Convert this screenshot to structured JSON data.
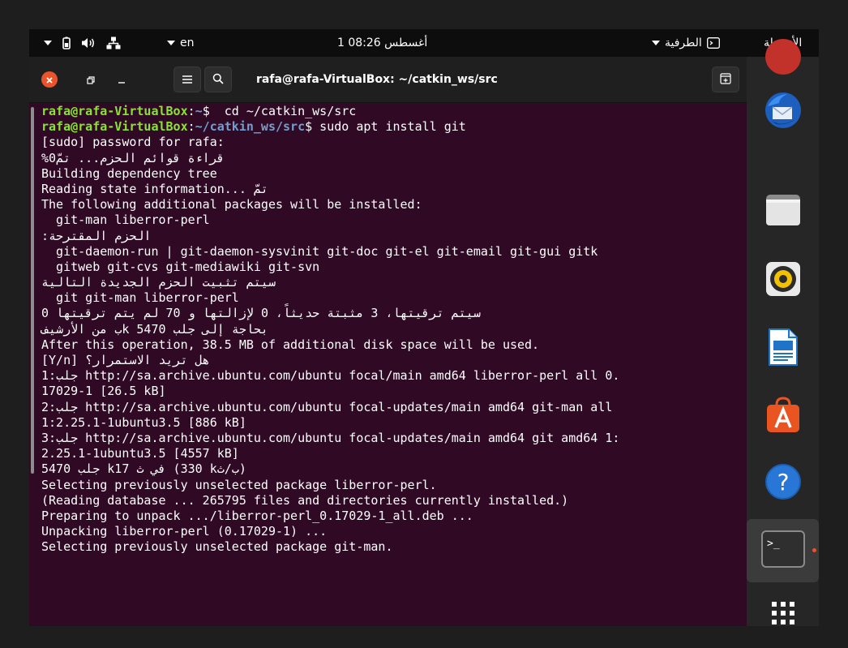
{
  "topbar": {
    "language": "en",
    "clock": "1 أغسطس 08:26",
    "terminal_menu": "الطرفية",
    "activities": "الأنشطة"
  },
  "window": {
    "title": "rafa@rafa-VirtualBox: ~/catkin_ws/src"
  },
  "terminal": {
    "lines": [
      {
        "type": "prompt",
        "user": "rafa@rafa-VirtualBox",
        "sep": ":",
        "path": "~",
        "cmd": "$  cd ~/catkin_ws/src"
      },
      {
        "type": "prompt",
        "user": "rafa@rafa-VirtualBox",
        "sep": ":",
        "path": "~/catkin_ws/src",
        "cmd": "$ sudo apt install git"
      },
      {
        "type": "text",
        "text": "[sudo] password for rafa:"
      },
      {
        "type": "text",
        "text": "%قراءة قوائم الحزم... تمّ0"
      },
      {
        "type": "text",
        "text": "Building dependency tree"
      },
      {
        "type": "text",
        "text": "Reading state information... تمّ"
      },
      {
        "type": "text",
        "text": "The following additional packages will be installed:"
      },
      {
        "type": "text",
        "text": "  git-man liberror-perl"
      },
      {
        "type": "text",
        "text": ":الحزم المقترحة"
      },
      {
        "type": "text",
        "text": "  git-daemon-run | git-daemon-sysvinit git-doc git-el git-email git-gui gitk"
      },
      {
        "type": "text",
        "text": "  gitweb git-cvs git-mediawiki git-svn"
      },
      {
        "type": "text",
        "text": "سيتم تثبيت الحزم الجديدة التالية"
      },
      {
        "type": "text",
        "text": "  git git-man liberror-perl"
      },
      {
        "type": "text",
        "text": "سيتم ترقيتها، 3 مثبتة حديثاً، 0 لإزالتها و 70 لم يتم ترقيتها 0"
      },
      {
        "type": "text",
        "text": "ب من الأرشيفk بحاجة إلى جلب 5470"
      },
      {
        "type": "text",
        "text": "After this operation, 38.5 MB of additional disk space will be used."
      },
      {
        "type": "text",
        "text": "[Y/n] هل تريد الاستمرار؟"
      },
      {
        "type": "text",
        "text": "1:جلب http://sa.archive.ubuntu.com/ubuntu focal/main amd64 liberror-perl all 0."
      },
      {
        "type": "text",
        "text": "17029-1 [26.5 kB]"
      },
      {
        "type": "text",
        "text": "2:جلب http://sa.archive.ubuntu.com/ubuntu focal-updates/main amd64 git-man all"
      },
      {
        "type": "text",
        "text": "1:2.25.1-1ubuntu3.5 [886 kB]"
      },
      {
        "type": "text",
        "text": "3:جلب http://sa.archive.ubuntu.com/ubuntu focal-updates/main amd64 git amd64 1:"
      },
      {
        "type": "text",
        "text": "2.25.1-1ubuntu3.5 [4557 kB]"
      },
      {
        "type": "text",
        "text": "جلب 5470 k17 في ث (330 kب/ث)"
      },
      {
        "type": "text",
        "text": "Selecting previously unselected package liberror-perl."
      },
      {
        "type": "text",
        "text": "(Reading database ... 265795 files and directories currently installed.)"
      },
      {
        "type": "text",
        "text": "Preparing to unpack .../liberror-perl_0.17029-1_all.deb ..."
      },
      {
        "type": "text",
        "text": "Unpacking liberror-perl (0.17029-1) ..."
      },
      {
        "type": "text",
        "text": "Selecting previously unselected package git-man."
      }
    ]
  },
  "dock": {
    "items": [
      {
        "name": "rhythmbox-partial",
        "icon": "rhythmbox-icon"
      },
      {
        "name": "thunderbird",
        "icon": "thunderbird-icon"
      },
      {
        "name": "files",
        "icon": "files-icon"
      },
      {
        "name": "rhythmbox",
        "icon": "speaker-icon"
      },
      {
        "name": "libreoffice-writer",
        "icon": "writer-icon"
      },
      {
        "name": "ubuntu-software",
        "icon": "software-store-icon"
      },
      {
        "name": "help",
        "icon": "help-icon",
        "glyph": "?"
      },
      {
        "name": "terminal",
        "icon": "terminal-icon",
        "glyph": ">_",
        "running": true
      },
      {
        "name": "show-applications",
        "icon": "app-grid-icon"
      }
    ]
  },
  "colors": {
    "terminal_bg": "#300a24",
    "prompt_user": "#8ae234",
    "prompt_path": "#729fcf",
    "close_button": "#e9542a",
    "dock_bg": "#262626"
  }
}
